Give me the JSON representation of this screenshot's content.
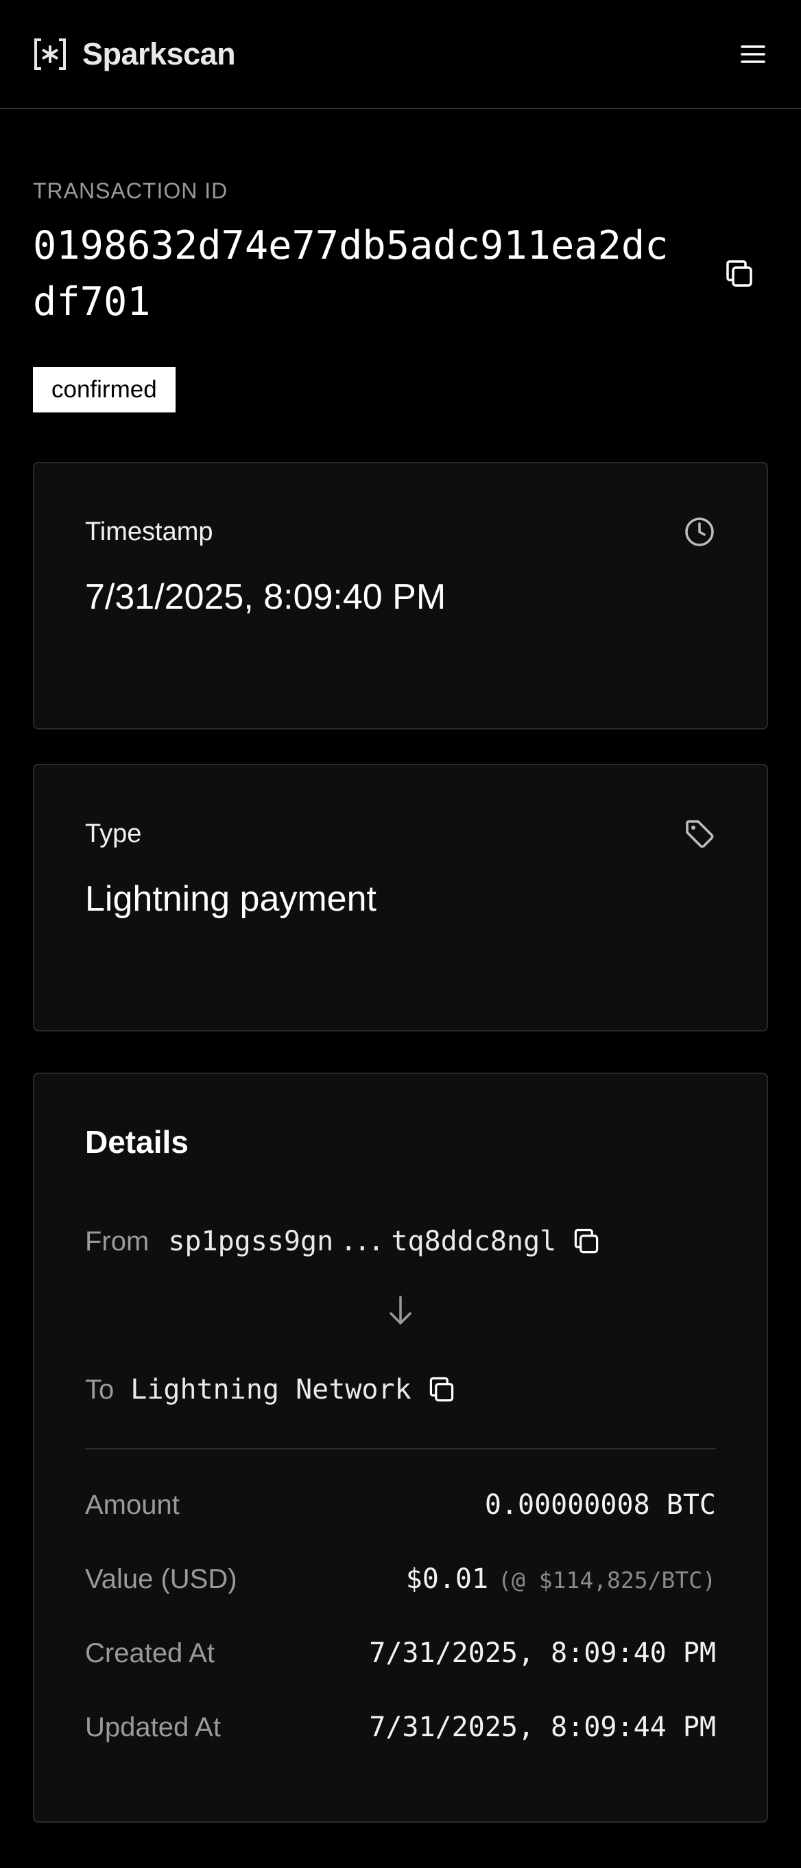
{
  "header": {
    "brand_name": "Sparkscan",
    "logo_glyph": "[*]",
    "menu_icon": "hamburger-menu-icon"
  },
  "transaction": {
    "id_label": "TRANSACTION ID",
    "id": "0198632d74e77db5adc911ea2dcdf701",
    "status": "confirmed"
  },
  "timestamp_card": {
    "title": "Timestamp",
    "value": "7/31/2025, 8:09:40 PM",
    "icon": "clock-icon"
  },
  "type_card": {
    "title": "Type",
    "value": "Lightning payment",
    "icon": "tag-icon"
  },
  "details": {
    "title": "Details",
    "from_label": "From",
    "from_value": "sp1pgss9gn",
    "from_ellipsis": "...",
    "from_value_end": "tq8ddc8ngl",
    "to_label": "To",
    "to_value": "Lightning Network",
    "rows": [
      {
        "label": "Amount",
        "value": "0.00000008 BTC",
        "note": ""
      },
      {
        "label": "Value (USD)",
        "value": "$0.01",
        "note": "(@ $114,825/BTC)"
      },
      {
        "label": "Created At",
        "value": "7/31/2025, 8:09:40 PM",
        "note": ""
      },
      {
        "label": "Updated At",
        "value": "7/31/2025, 8:09:44 PM",
        "note": ""
      }
    ]
  },
  "colors": {
    "background": "#000000",
    "card": "#0e0e0e",
    "border": "#2a2a2a",
    "muted_text": "#9a9a9a",
    "badge_bg": "#ffffff"
  }
}
